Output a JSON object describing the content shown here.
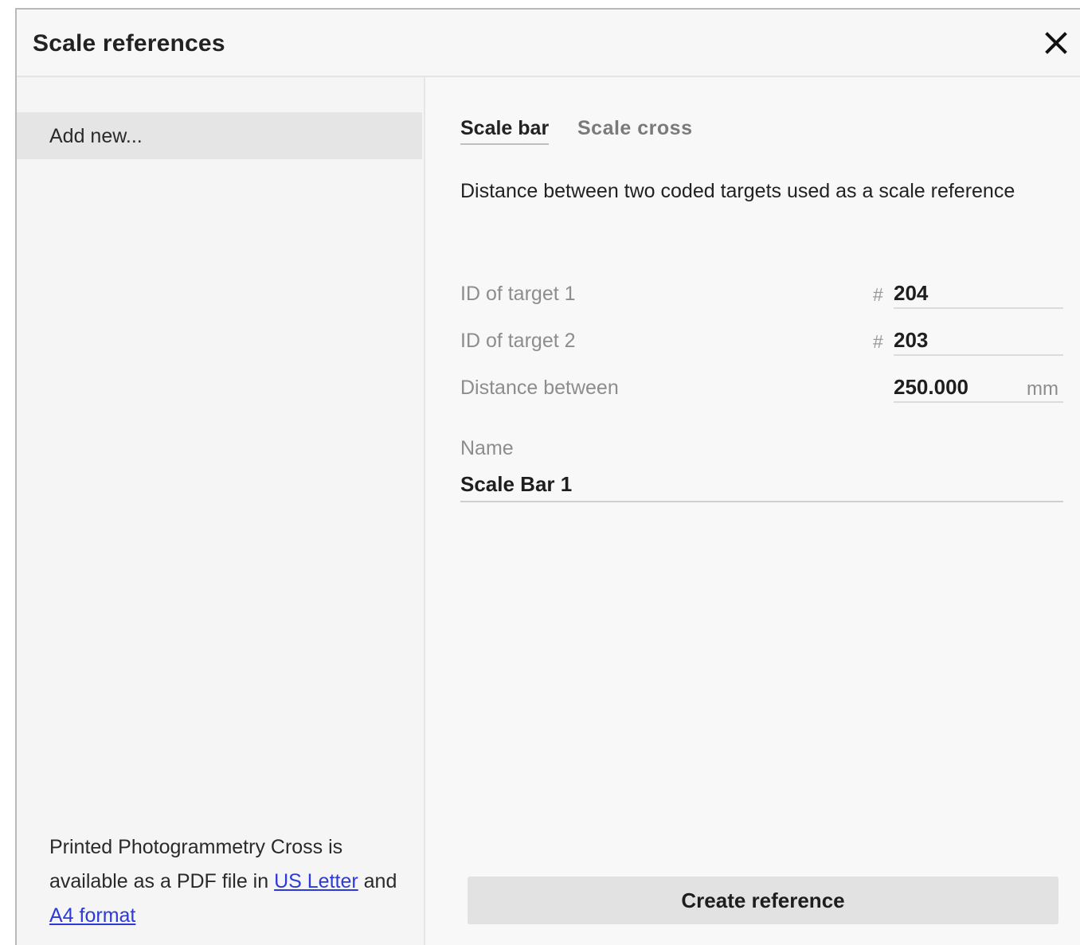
{
  "dialog": {
    "title": "Scale references",
    "close_icon": "close-icon"
  },
  "sidebar": {
    "add_new_label": "Add new...",
    "info": {
      "text_before": "Printed Photogrammetry Cross is available as a PDF file in ",
      "link_us_letter": "US Letter",
      "text_middle": " and ",
      "link_a4": "A4 format"
    }
  },
  "tabs": [
    {
      "label": "Scale bar",
      "active": true
    },
    {
      "label": "Scale cross",
      "active": false
    }
  ],
  "form": {
    "description": "Distance between two coded targets used as a scale reference",
    "target1": {
      "label": "ID of target 1",
      "prefix": "#",
      "value": "204"
    },
    "target2": {
      "label": "ID of target 2",
      "prefix": "#",
      "value": "203"
    },
    "distance": {
      "label": "Distance between",
      "value": "250.000",
      "unit": "mm"
    },
    "name": {
      "label": "Name",
      "value": "Scale Bar 1"
    }
  },
  "actions": {
    "create_label": "Create reference"
  },
  "colors": {
    "link": "#2d3ad8",
    "button_bg": "#e2e2e2",
    "selected_item_bg": "#e5e5e5"
  }
}
